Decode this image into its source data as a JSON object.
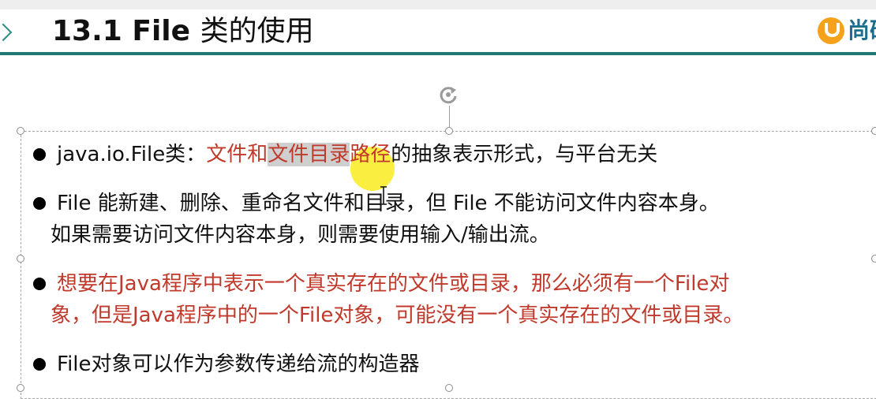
{
  "slide": {
    "title_number": "13.1",
    "title_word": "File",
    "title_cn": "类的使用",
    "logo_text": "尚硅"
  },
  "bullets": [
    {
      "parts": [
        {
          "text": "java.io.File类：",
          "style": "normal"
        },
        {
          "text": "文件和",
          "style": "red"
        },
        {
          "text": "文件目录",
          "style": "red-highlight"
        },
        {
          "text": "路径",
          "style": "red"
        },
        {
          "text": "的抽象表示形式，与平台无关",
          "style": "normal"
        }
      ]
    },
    {
      "line1": "File 能新建、删除、重命名文件和目录，但 File 不能访问文件内容本身。",
      "line2": "如果需要访问文件内容本身，则需要使用输入/输出流。"
    },
    {
      "line1": "想要在Java程序中表示一个真实存在的文件或目录，那么必须有一个File对",
      "line2": "象，但是Java程序中的一个File对象，可能没有一个真实存在的文件或目录。"
    },
    {
      "line1": "File对象可以作为参数传递给流的构造器"
    }
  ],
  "colors": {
    "accent_teal": "#1f7a74",
    "emphasis_red": "#c0392b",
    "highlight_yellow": "#f8e800",
    "logo_orange": "#f4a21c"
  },
  "icons": {
    "nav": "chevron-right-icon",
    "rotate": "rotate-handle-icon",
    "logo": "brand-logo-icon",
    "cursor": "text-cursor-icon"
  }
}
